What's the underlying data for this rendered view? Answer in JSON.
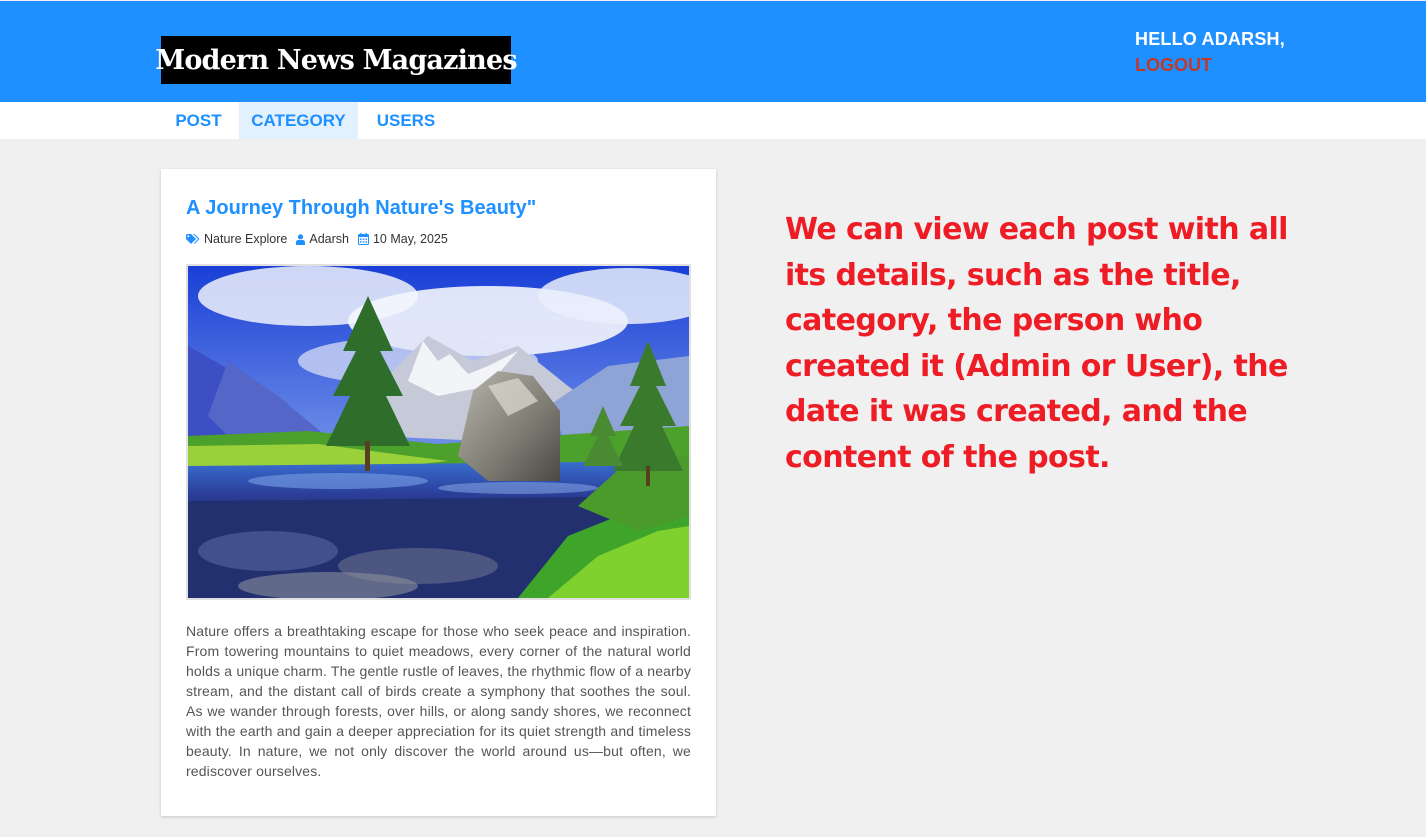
{
  "header": {
    "logo": "Modern News Magazines",
    "greeting": "HELLO ADARSH,",
    "logout_label": "LOGOUT",
    "background_color": "#1e90ff"
  },
  "menu": {
    "items": [
      {
        "label": "POST",
        "active": false
      },
      {
        "label": "CATEGORY",
        "active": true
      },
      {
        "label": "USERS",
        "active": false
      }
    ]
  },
  "post": {
    "title": "A Journey Through Nature's Beauty\"",
    "category": "Nature Explore",
    "author": "Adarsh",
    "date": "10 May, 2025",
    "image_icon": "landscape-image",
    "content": "Nature offers a breathtaking escape for those who seek peace and inspiration. From towering mountains to quiet meadows, every corner of the natural world holds a unique charm. The gentle rustle of leaves, the rhythmic flow of a nearby stream, and the distant call of birds create a symphony that soothes the soul. As we wander through forests, over hills, or along sandy shores, we reconnect with the earth and gain a deeper appreciation for its quiet strength and timeless beauty. In nature, we not only discover the world around us—but often, we rediscover ourselves."
  },
  "annotation": {
    "text": "We can view each post with all its details, such as the title, category, the person who created it (Admin or User), the date it was created, and the content of the post.",
    "color": "#ee1c25"
  }
}
